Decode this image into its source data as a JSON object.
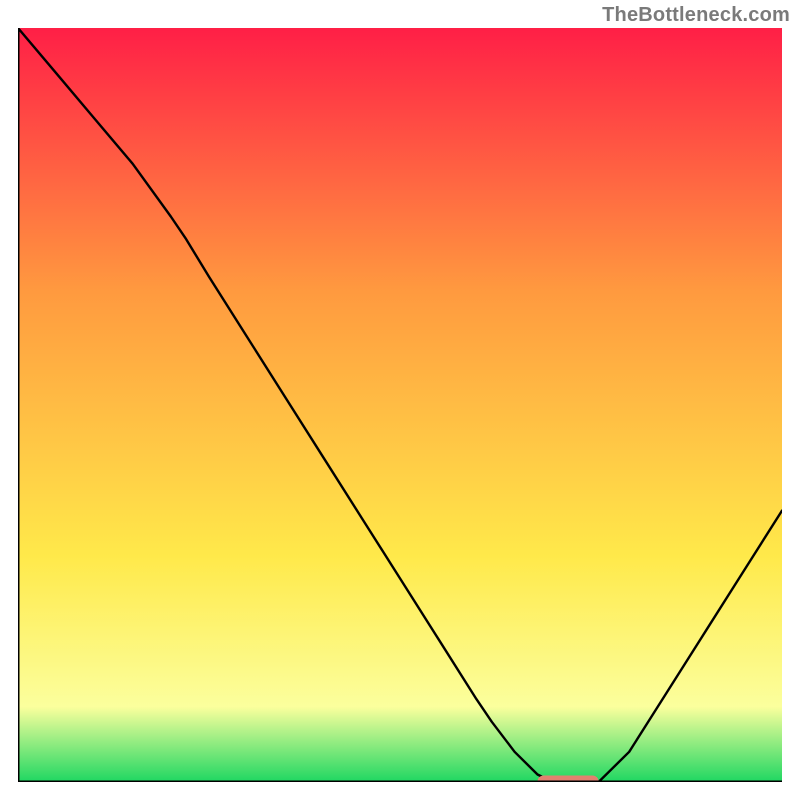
{
  "watermark": "TheBottleneck.com",
  "colors": {
    "gradient_top": "#ff1f46",
    "gradient_mid1": "#ff9a3f",
    "gradient_mid2": "#ffe94a",
    "gradient_mid3": "#fbff9d",
    "gradient_bottom": "#1fd762",
    "curve": "#000000",
    "axis": "#000000",
    "marker": "#e2816f"
  },
  "chart_data": {
    "type": "line",
    "title": "",
    "xlabel": "",
    "ylabel": "",
    "xlim": [
      0,
      100
    ],
    "ylim": [
      0,
      100
    ],
    "grid": false,
    "legend": false,
    "x": [
      0,
      5,
      10,
      15,
      20,
      22,
      25,
      30,
      35,
      40,
      45,
      50,
      55,
      60,
      62,
      65,
      68,
      70,
      73,
      76,
      80,
      85,
      90,
      95,
      100
    ],
    "values": [
      100,
      94,
      88,
      82,
      75,
      72,
      67,
      59,
      51,
      43,
      35,
      27,
      19,
      11,
      8,
      4,
      1,
      0,
      0,
      0,
      4,
      12,
      20,
      28,
      36
    ],
    "marker": {
      "x_start": 68,
      "x_end": 76,
      "y": 0
    }
  }
}
